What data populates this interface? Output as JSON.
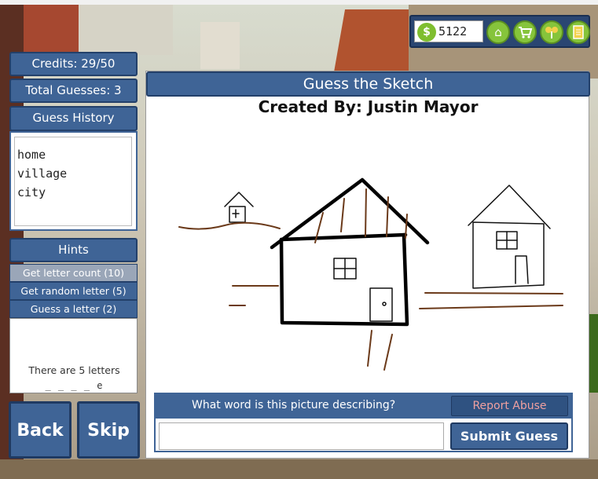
{
  "stats": {
    "credits": "Credits: 29/50",
    "total_guesses": "Total Guesses: 3"
  },
  "history": {
    "title": "Guess History",
    "items": [
      "home",
      "village",
      "city"
    ]
  },
  "hints": {
    "title": "Hints",
    "buttons": [
      "Get letter count (10)",
      "Get random letter (5)",
      "Guess a letter (2)"
    ],
    "result_text": "There are 5 letters",
    "pattern": "_ _ _ _ e"
  },
  "nav": {
    "back": "Back",
    "skip": "Skip"
  },
  "coins": {
    "value": "5122",
    "icon": "money-bag-icon"
  },
  "toolbar_icons": [
    "home-icon",
    "cart-icon",
    "tree-icon",
    "notepad-icon"
  ],
  "main": {
    "title": "Guess the Sketch",
    "creator": "Created By: Justin Mayor",
    "question": "What word is this picture describing?",
    "report": "Report Abuse",
    "submit": "Submit Guess",
    "input_value": ""
  },
  "colors": {
    "panel_blue": "#3f6496",
    "panel_border": "#23406a",
    "report_text": "#f0a0a0",
    "sketch_brown": "#6b3a1a",
    "coin_green": "#86c43b"
  }
}
